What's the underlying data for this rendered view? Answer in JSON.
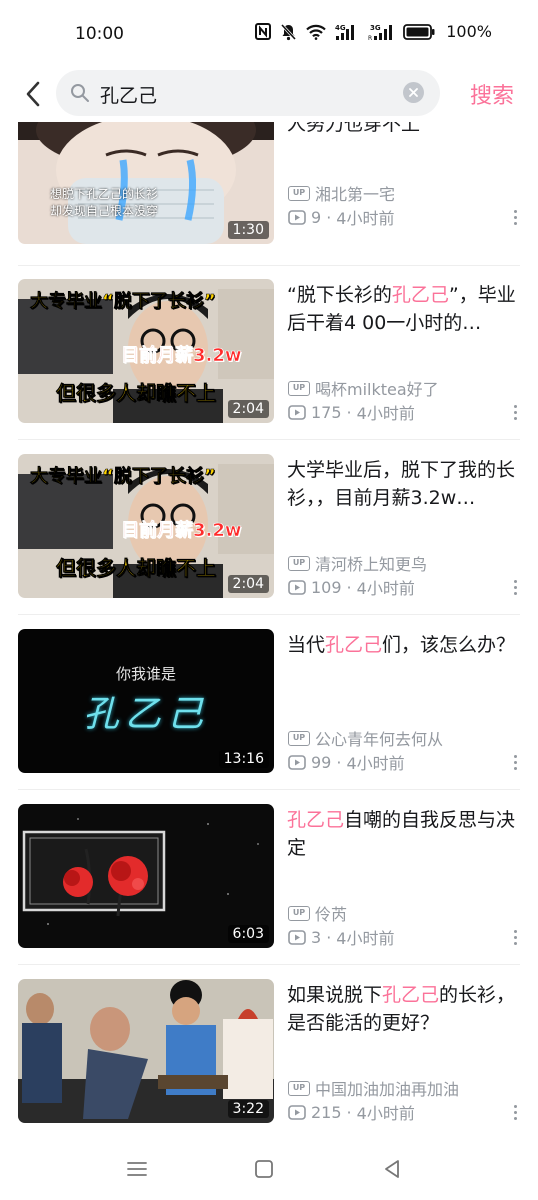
{
  "status_bar": {
    "time": "10:00",
    "battery": "100%",
    "network_a": "4G",
    "network_b": "3G"
  },
  "search": {
    "query": "孔乙己",
    "submit_label": "搜索"
  },
  "results": [
    {
      "title_pre": "",
      "title_hl": "",
      "title_post": "人努力也穿不上",
      "thumb_caption_1": "想脱下孔乙己的长衫",
      "thumb_caption_2": "却发现自己根本没穿",
      "author": "湘北第一宅",
      "views": "9",
      "time": "4小时前",
      "duration": "1:30"
    },
    {
      "title_pre": "“脱下长衫的",
      "title_hl": "孔乙己",
      "title_post": "”，毕业后干着4 00一小时的…",
      "thumb_text_1": "大专毕业“脱下了长衫”",
      "thumb_text_2": "目前月薪3.2w",
      "thumb_text_3": "但很多人却瞧不上",
      "author": "喝杯milktea好了",
      "views": "175",
      "time": "4小时前",
      "duration": "2:04"
    },
    {
      "title_pre": "大学毕业后，脱下了我的长衫，，目前月薪3.2w…",
      "title_hl": "",
      "title_post": "",
      "thumb_text_1": "大专毕业“脱下了长衫”",
      "thumb_text_2": "目前月薪3.2w",
      "thumb_text_3": "但很多人却瞧不上",
      "author": "清河桥上知更鸟",
      "views": "109",
      "time": "4小时前",
      "duration": "2:04"
    },
    {
      "title_pre": "当代",
      "title_hl": "孔乙己",
      "title_post": "们，该怎么办？",
      "thumb_text_1": "你我谁是",
      "thumb_text_2": "孔乙己",
      "author": "公心青年何去何从",
      "views": "99",
      "time": "4小时前",
      "duration": "13:16"
    },
    {
      "title_pre": "",
      "title_hl": "孔乙己",
      "title_post": "自嘲的自我反思与决定",
      "author": "伶芮",
      "views": "3",
      "time": "4小时前",
      "duration": "6:03"
    },
    {
      "title_pre": "如果说脱下",
      "title_hl": "孔乙己",
      "title_post": "的长衫，是否能活的更好？",
      "author": "中国加油加油再加油",
      "views": "215",
      "time": "4小时前",
      "duration": "3:22"
    }
  ],
  "labels": {
    "up": "UP",
    "sep": "·"
  },
  "colors": {
    "accent": "#fb7299",
    "text": "#18191c",
    "meta": "#9499a0",
    "search_bg": "#f1f2f3"
  }
}
